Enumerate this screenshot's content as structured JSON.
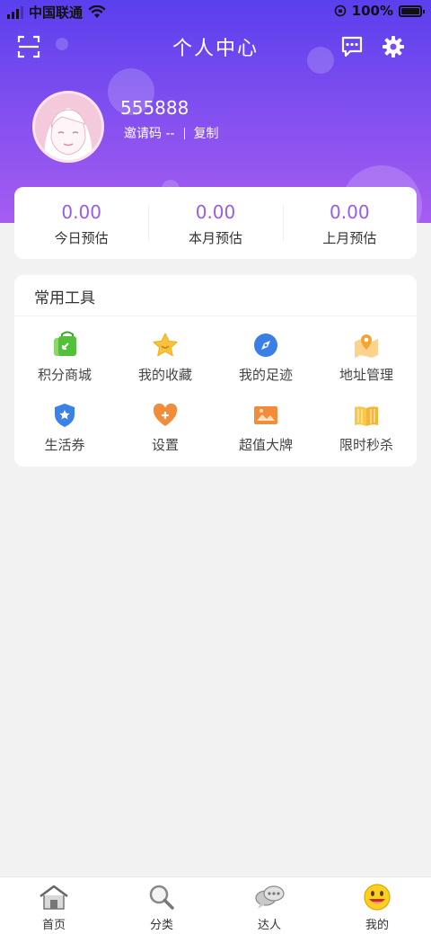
{
  "status_bar": {
    "carrier": "中国联通",
    "battery": "100%"
  },
  "header": {
    "title": "个人中心"
  },
  "profile": {
    "user_id": "555888",
    "invite_label": "邀请码 --",
    "copy_label": "复制"
  },
  "stats": [
    {
      "value": "0.00",
      "label": "今日预估"
    },
    {
      "value": "0.00",
      "label": "本月预估"
    },
    {
      "value": "0.00",
      "label": "上月预估"
    }
  ],
  "tools": {
    "title": "常用工具",
    "items": [
      {
        "label": "积分商城",
        "icon": "shopping-bag-icon"
      },
      {
        "label": "我的收藏",
        "icon": "star-icon"
      },
      {
        "label": "我的足迹",
        "icon": "compass-icon"
      },
      {
        "label": "地址管理",
        "icon": "map-pin-icon"
      },
      {
        "label": "生活券",
        "icon": "shield-star-icon"
      },
      {
        "label": "设置",
        "icon": "heart-plus-icon"
      },
      {
        "label": "超值大牌",
        "icon": "image-icon"
      },
      {
        "label": "限时秒杀",
        "icon": "book-icon"
      }
    ]
  },
  "tabbar": [
    {
      "label": "首页",
      "icon": "home-icon"
    },
    {
      "label": "分类",
      "icon": "search-icon"
    },
    {
      "label": "达人",
      "icon": "chat-bubbles-icon"
    },
    {
      "label": "我的",
      "icon": "smiley-icon"
    }
  ],
  "colors": {
    "accent": "#9a5ce8",
    "header_gradient_top": "#5a3fee",
    "header_gradient_bottom": "#a65cf1"
  }
}
